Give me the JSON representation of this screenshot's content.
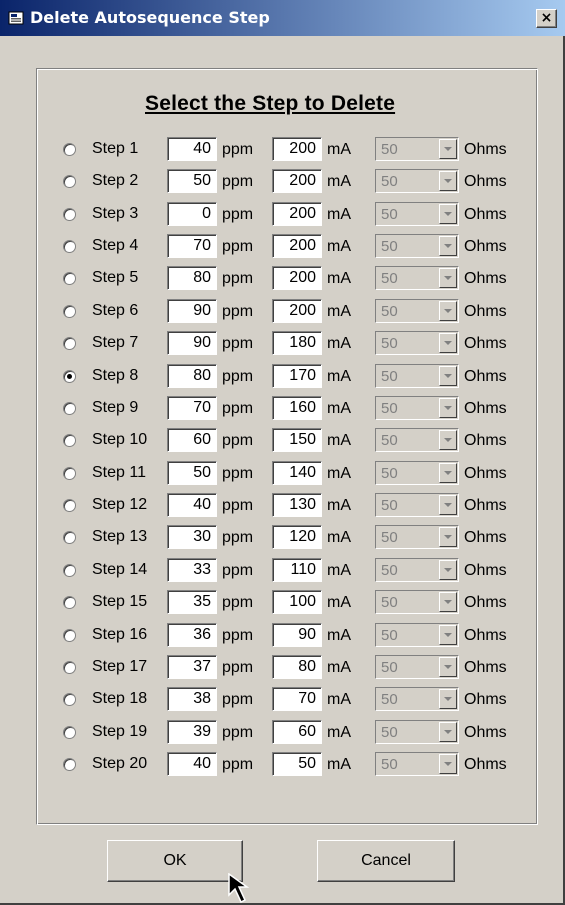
{
  "window": {
    "title": "Delete Autosequence Step",
    "close_label": "×"
  },
  "heading": "Select the Step to Delete",
  "units": {
    "ppm": "ppm",
    "ma": "mA",
    "ohms": "Ohms"
  },
  "steps": [
    {
      "label": "Step 1",
      "ppm": "40",
      "ma": "200",
      "ohms": "50",
      "selected": false
    },
    {
      "label": "Step 2",
      "ppm": "50",
      "ma": "200",
      "ohms": "50",
      "selected": false
    },
    {
      "label": "Step 3",
      "ppm": "0",
      "ma": "200",
      "ohms": "50",
      "selected": false
    },
    {
      "label": "Step 4",
      "ppm": "70",
      "ma": "200",
      "ohms": "50",
      "selected": false
    },
    {
      "label": "Step 5",
      "ppm": "80",
      "ma": "200",
      "ohms": "50",
      "selected": false
    },
    {
      "label": "Step 6",
      "ppm": "90",
      "ma": "200",
      "ohms": "50",
      "selected": false
    },
    {
      "label": "Step 7",
      "ppm": "90",
      "ma": "180",
      "ohms": "50",
      "selected": false
    },
    {
      "label": "Step 8",
      "ppm": "80",
      "ma": "170",
      "ohms": "50",
      "selected": true
    },
    {
      "label": "Step 9",
      "ppm": "70",
      "ma": "160",
      "ohms": "50",
      "selected": false
    },
    {
      "label": "Step 10",
      "ppm": "60",
      "ma": "150",
      "ohms": "50",
      "selected": false
    },
    {
      "label": "Step 11",
      "ppm": "50",
      "ma": "140",
      "ohms": "50",
      "selected": false
    },
    {
      "label": "Step 12",
      "ppm": "40",
      "ma": "130",
      "ohms": "50",
      "selected": false
    },
    {
      "label": "Step 13",
      "ppm": "30",
      "ma": "120",
      "ohms": "50",
      "selected": false
    },
    {
      "label": "Step 14",
      "ppm": "33",
      "ma": "110",
      "ohms": "50",
      "selected": false
    },
    {
      "label": "Step 15",
      "ppm": "35",
      "ma": "100",
      "ohms": "50",
      "selected": false
    },
    {
      "label": "Step 16",
      "ppm": "36",
      "ma": "90",
      "ohms": "50",
      "selected": false
    },
    {
      "label": "Step 17",
      "ppm": "37",
      "ma": "80",
      "ohms": "50",
      "selected": false
    },
    {
      "label": "Step 18",
      "ppm": "38",
      "ma": "70",
      "ohms": "50",
      "selected": false
    },
    {
      "label": "Step 19",
      "ppm": "39",
      "ma": "60",
      "ohms": "50",
      "selected": false
    },
    {
      "label": "Step 20",
      "ppm": "40",
      "ma": "50",
      "ohms": "50",
      "selected": false
    }
  ],
  "buttons": {
    "ok": "OK",
    "cancel": "Cancel"
  },
  "colors": {
    "title_start": "#0a246a",
    "title_end": "#a6caf0",
    "face": "#d4d0c8"
  }
}
